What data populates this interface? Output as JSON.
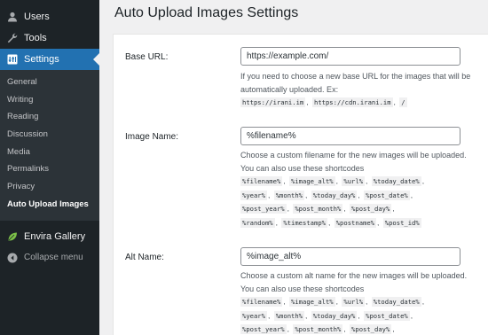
{
  "sidebar": {
    "users_label": "Users",
    "tools_label": "Tools",
    "settings_label": "Settings",
    "submenu": [
      "General",
      "Writing",
      "Reading",
      "Discussion",
      "Media",
      "Permalinks",
      "Privacy",
      "Auto Upload Images"
    ],
    "envira_label": "Envira Gallery",
    "collapse_label": "Collapse menu"
  },
  "page": {
    "title": "Auto Upload Images Settings"
  },
  "base_url": {
    "label": "Base URL:",
    "value": "https://example.com/",
    "description": "If you need to choose a new base URL for the images that will be automatically uploaded. Ex:",
    "examples": [
      "https://irani.im",
      "https://cdn.irani.im",
      "/"
    ]
  },
  "image_name": {
    "label": "Image Name:",
    "value": "%filename%",
    "description": "Choose a custom filename for the new images will be uploaded. You can also use these shortcodes",
    "shortcodes": [
      "%filename%",
      "%image_alt%",
      "%url%",
      "%today_date%",
      "%year%",
      "%month%",
      "%today_day%",
      "%post_date%",
      "%post_year%",
      "%post_month%",
      "%post_day%",
      "%random%",
      "%timestamp%",
      "%postname%",
      "%post_id%"
    ]
  },
  "alt_name": {
    "label": "Alt Name:",
    "value": "%image_alt%",
    "description": "Choose a custom alt name for the new images will be uploaded. You can also use these shortcodes",
    "shortcodes": [
      "%filename%",
      "%image_alt%",
      "%url%",
      "%today_date%",
      "%year%",
      "%month%",
      "%today_day%",
      "%post_date%",
      "%post_year%",
      "%post_month%",
      "%post_day%"
    ]
  },
  "colors": {
    "sidebar_bg": "#1d2327",
    "submenu_bg": "#2c3338",
    "accent": "#2271b1"
  }
}
